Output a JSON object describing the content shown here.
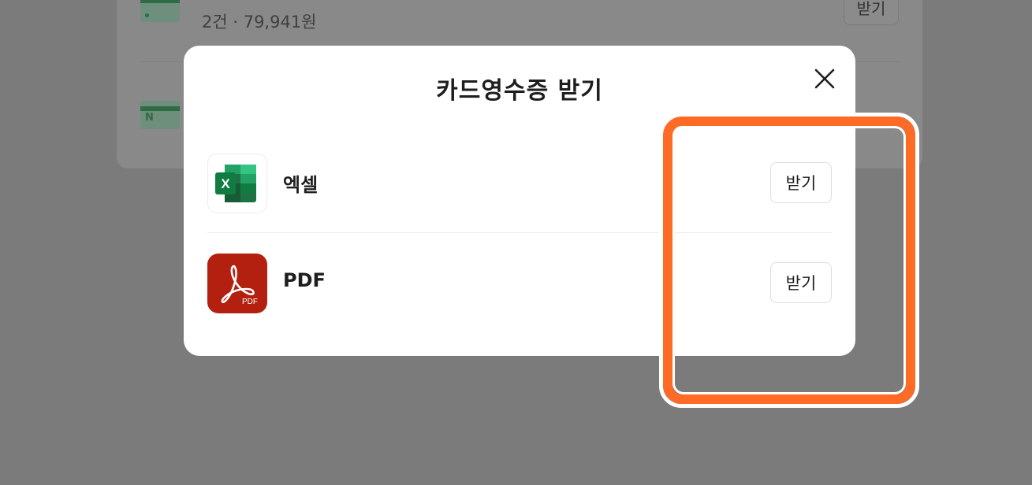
{
  "background": {
    "sub_text": "2건 · 79,941원",
    "button_label": "받기"
  },
  "modal": {
    "title": "카드영수증 받기",
    "rows": [
      {
        "label": "엑셀",
        "button_label": "받기",
        "icon": "excel-icon"
      },
      {
        "label": "PDF",
        "button_label": "받기",
        "icon": "pdf-icon"
      }
    ]
  },
  "pdf_icon_text": "PDF",
  "excel_icon_text": "X",
  "colors": {
    "highlight": "#ff6b25",
    "excel_green": "#1f7244",
    "pdf_red": "#b3200f"
  }
}
